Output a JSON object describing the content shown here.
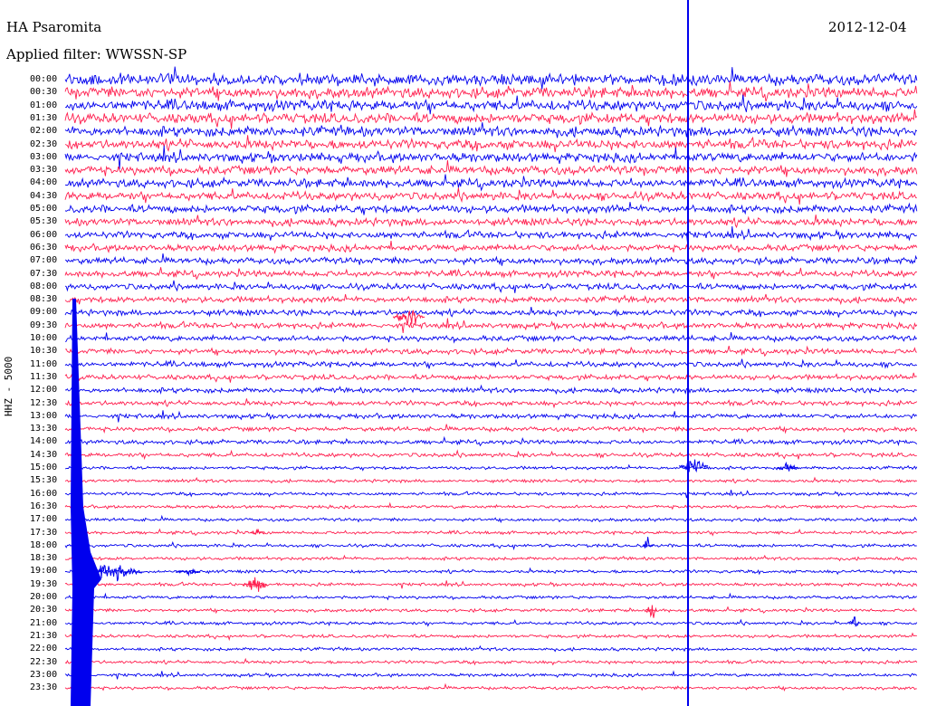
{
  "header": {
    "station": "HA Psaromita",
    "date": "2012-12-04",
    "filter": "Applied filter: WWSSN-SP",
    "channel": "HHZ - 5000"
  },
  "colors": {
    "trace_a": "#0000ee",
    "trace_b": "#ff1e4e",
    "marker": "#0000ee",
    "background": "#ffffff"
  },
  "time_labels": [
    "00:00",
    "00:30",
    "01:00",
    "01:30",
    "02:00",
    "02:30",
    "03:00",
    "03:30",
    "04:00",
    "04:30",
    "05:00",
    "05:30",
    "06:00",
    "06:30",
    "07:00",
    "07:30",
    "08:00",
    "08:30",
    "09:00",
    "09:30",
    "10:00",
    "10:30",
    "11:00",
    "11:30",
    "12:00",
    "12:30",
    "13:00",
    "13:30",
    "14:00",
    "14:30",
    "15:00",
    "15:30",
    "16:00",
    "16:30",
    "17:00",
    "17:30",
    "18:00",
    "18:30",
    "19:00",
    "19:30",
    "20:00",
    "20:30",
    "21:00",
    "21:30",
    "22:00",
    "22:30",
    "23:00",
    "23:30"
  ]
}
